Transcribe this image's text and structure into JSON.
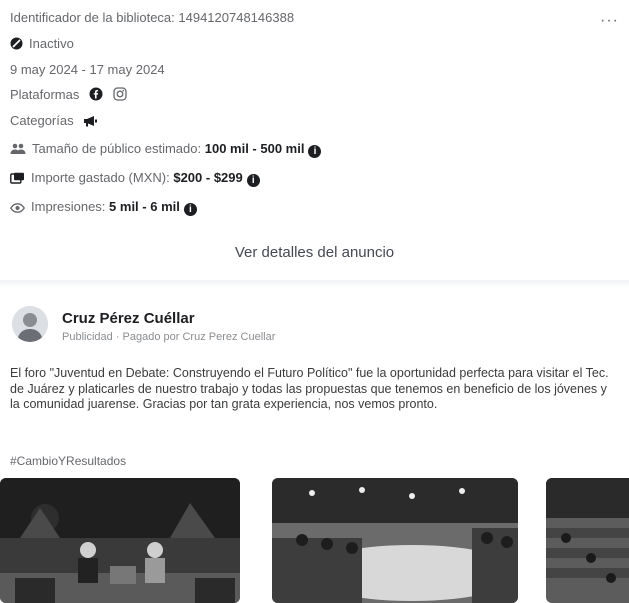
{
  "ad": {
    "library_id": "Identificador de la biblioteca: 1494120748146388",
    "status": "Inactivo",
    "date_range": "9 may 2024 - 17 may 2024",
    "platforms_label": "Plataformas",
    "categories_label": "Categorías",
    "audience": {
      "label": "Tamaño de público estimado:",
      "value": "100 mil - 500 mil"
    },
    "spend": {
      "label": "Importe gastado (MXN):",
      "value": "$200 - $299"
    },
    "impressions": {
      "label": "Impresiones:",
      "value": "5 mil - 6 mil"
    },
    "details_button": "Ver detalles del anuncio",
    "more_icon": "more-dots-icon"
  },
  "post": {
    "page_name": "Cruz Pérez Cuéllar",
    "sponsor_prefix": "Publicidad · ",
    "sponsor_paid": "Pagado por Cruz Perez Cuellar",
    "body": "El foro \"Juventud en Debate: Construyendo el Futuro Político\" fue la oportunidad perfecta para visitar el Tec. de Juárez y platicarles de nuestro trabajo y todas las propuestas que tenemos en beneficio de los jóvenes y la comunidad juarense. Gracias por tan grata experiencia, nos vemos pronto.",
    "hashtag": "#CambioYResultados"
  },
  "icons": {
    "status": "inactive-icon",
    "platforms": [
      "facebook-icon",
      "instagram-icon"
    ],
    "category": "megaphone-icon",
    "audience": "people-icon",
    "spend": "money-icon",
    "impressions": "eye-icon",
    "info": "info-icon"
  },
  "colors": {
    "text": "#1c1e21",
    "muted": "#65676b",
    "background": "#ffffff"
  }
}
